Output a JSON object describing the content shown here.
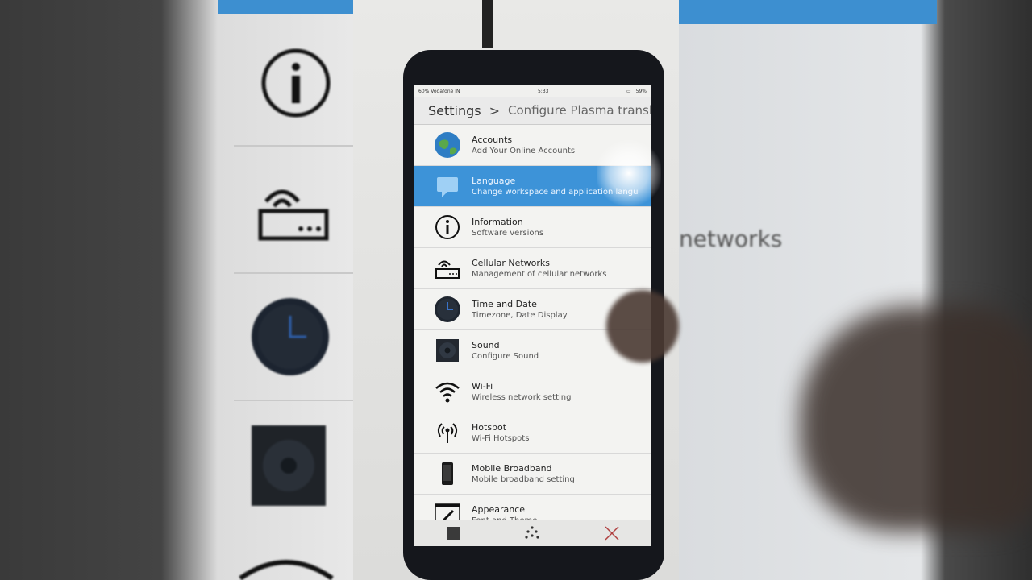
{
  "status_bar": {
    "carrier": "60% Vodafone IN",
    "time": "5:33",
    "battery": "59%"
  },
  "breadcrumb": {
    "root": "Settings",
    "separator": ">",
    "current": "Configure Plasma transla"
  },
  "settings_items": [
    {
      "title": "Accounts",
      "subtitle": "Add Your Online Accounts",
      "icon": "globe-icon"
    },
    {
      "title": "Language",
      "subtitle": "Change workspace and application langu",
      "icon": "speech-bubble-icon",
      "selected": true
    },
    {
      "title": "Information",
      "subtitle": "Software versions",
      "icon": "info-icon"
    },
    {
      "title": "Cellular Networks",
      "subtitle": "Management of cellular networks",
      "icon": "router-icon"
    },
    {
      "title": "Time and Date",
      "subtitle": "Timezone, Date Display",
      "icon": "clock-icon"
    },
    {
      "title": "Sound",
      "subtitle": "Configure Sound",
      "icon": "speaker-icon"
    },
    {
      "title": "Wi-Fi",
      "subtitle": "Wireless network setting",
      "icon": "wifi-icon"
    },
    {
      "title": "Hotspot",
      "subtitle": "Wi-Fi Hotspots",
      "icon": "hotspot-icon"
    },
    {
      "title": "Mobile Broadband",
      "subtitle": "Mobile broadband setting",
      "icon": "phone-icon"
    },
    {
      "title": "Appearance",
      "subtitle": "Font and Theme",
      "icon": "brush-icon"
    }
  ],
  "background_text": {
    "right_partial": "networks"
  },
  "colors": {
    "selected": "#3d93d8",
    "accent_bar": "#3d8fd0"
  }
}
